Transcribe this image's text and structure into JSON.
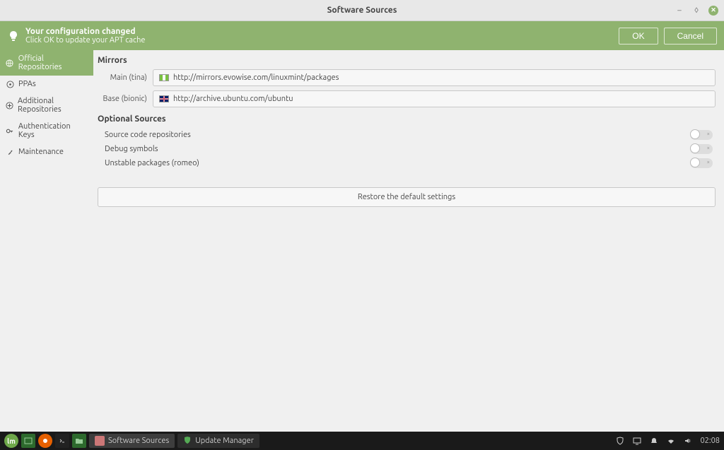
{
  "window": {
    "title": "Software Sources"
  },
  "notification": {
    "line1": "Your configuration changed",
    "line2": "Click OK to update your APT cache",
    "ok": "OK",
    "cancel": "Cancel"
  },
  "sidebar": {
    "items": [
      {
        "label": "Official Repositories"
      },
      {
        "label": "PPAs"
      },
      {
        "label": "Additional Repositories"
      },
      {
        "label": "Authentication Keys"
      },
      {
        "label": "Maintenance"
      }
    ]
  },
  "main": {
    "mirrors_heading": "Mirrors",
    "main_label": "Main (tina)",
    "main_url": "http://mirrors.evowise.com/linuxmint/packages",
    "base_label": "Base (bionic)",
    "base_url": "http://archive.ubuntu.com/ubuntu",
    "optional_heading": "Optional Sources",
    "opt_source": "Source code repositories",
    "opt_debug": "Debug symbols",
    "opt_unstable": "Unstable packages (romeo)",
    "restore": "Restore the default settings"
  },
  "taskbar": {
    "app1": "Software Sources",
    "app2": "Update Manager",
    "clock": "02:08"
  }
}
